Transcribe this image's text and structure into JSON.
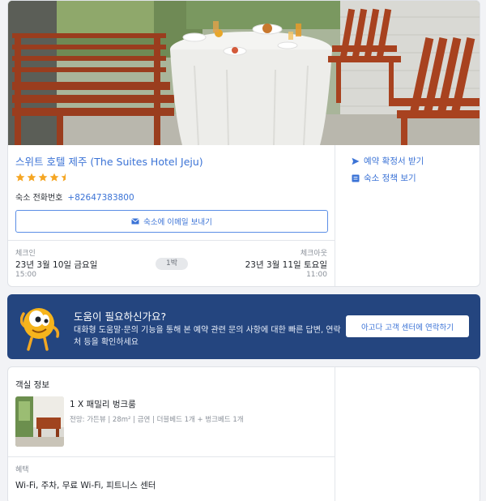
{
  "hotel": {
    "name": "스위트 호텔 제주 (The Suites Hotel Jeju)",
    "rating": 4.5,
    "phone_label": "숙소 전화번호",
    "phone_number": "+82647383800",
    "email_button_label": "숙소에 이메일 보내기"
  },
  "stay": {
    "checkin_label": "체크인",
    "checkin_date": "23년 3월 10일 금요일",
    "checkin_time": "15:00",
    "nights": "1박",
    "checkout_label": "체크아웃",
    "checkout_date": "23년 3월 11일 토요일",
    "checkout_time": "11:00"
  },
  "side_links": {
    "confirmation": "예약 확정서 받기",
    "policy": "숙소 정책 보기"
  },
  "help": {
    "title": "도움이 필요하신가요?",
    "description": "대화형 도움말·문의 기능을 통해 본 예약 관련 문의 사항에 대한 빠른 답변, 연락처 등을 확인하세요",
    "button_label": "아고다 고객 센터에 연락하기"
  },
  "room": {
    "heading": "객실 정보",
    "name": "1 X 패밀리 벙크룸",
    "details": "전망: 가든뷰 | 28m² | 금연 | 더블베드 1개 + 벙크베드 1개",
    "benefits_label": "혜택",
    "benefits": "Wi-Fi, 주차, 무료 Wi-Fi, 피트니스 센터"
  },
  "colors": {
    "accent": "#3b73d6",
    "banner": "#24457f",
    "star": "#f5a623"
  },
  "icons": {
    "email": "envelope-icon",
    "confirmation": "send-arrow-icon",
    "policy": "document-icon",
    "mascot": "agoda-mascot-icon"
  }
}
